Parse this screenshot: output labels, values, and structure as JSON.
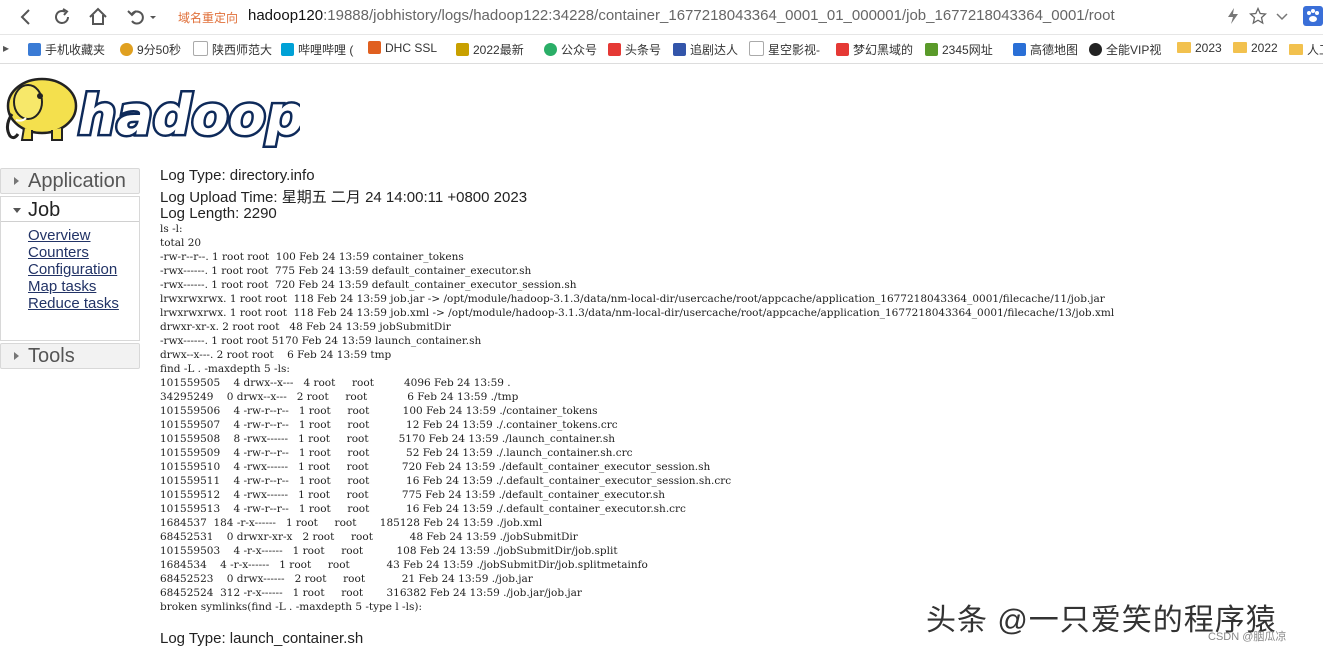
{
  "browser": {
    "redirect_label": "域名重定向",
    "url_host": "hadoop120",
    "url_rest": ":19888/jobhistory/logs/hadoop122:34228/container_1677218043364_0001_01_000001/job_1677218043364_0001/root"
  },
  "bookmarks": [
    {
      "label": "手机收藏夹",
      "icon": "phone-bookmark-icon",
      "color": "#3a7bd5"
    },
    {
      "label": "9分50秒",
      "icon": "trophy-icon",
      "color": "#e0a020"
    },
    {
      "label": "陕西师范大",
      "icon": "page-icon",
      "color": "#bbbbbb"
    },
    {
      "label": "哔哩哔哩 (",
      "icon": "bilibili-icon",
      "color": "#00a1d6"
    },
    {
      "label": "DHC SSL",
      "icon": "dhc-icon",
      "color": "#e06020"
    },
    {
      "label": "2022最新",
      "icon": "news-icon",
      "color": "#c8a000"
    },
    {
      "label": "公众号",
      "icon": "wechat-icon",
      "color": "#2aae67"
    },
    {
      "label": "头条号",
      "icon": "toutiao-icon",
      "color": "#e53935"
    },
    {
      "label": "追剧达人",
      "icon": "tv-icon",
      "color": "#3355aa"
    },
    {
      "label": "星空影视-",
      "icon": "page-icon",
      "color": "#bbbbbb"
    },
    {
      "label": "梦幻黑域的",
      "icon": "c-icon",
      "color": "#e53935"
    },
    {
      "label": "2345网址",
      "icon": "2345-icon",
      "color": "#5a9a2a"
    },
    {
      "label": "高德地图",
      "icon": "map-arrow-icon",
      "color": "#2a6fd6"
    },
    {
      "label": "全能VIP视",
      "icon": "vip-icon",
      "color": "#222222"
    },
    {
      "label": "2023",
      "icon": "folder-icon",
      "color": "#f2c14e"
    },
    {
      "label": "2022",
      "icon": "folder-icon",
      "color": "#f2c14e"
    },
    {
      "label": "人工",
      "icon": "folder-icon",
      "color": "#f2c14e"
    }
  ],
  "logo": {
    "text": "hadoop"
  },
  "sidebar": {
    "application": "Application",
    "job": "Job",
    "job_links": [
      "Overview",
      "Counters",
      "Configuration",
      "Map tasks",
      "Reduce tasks"
    ],
    "tools": "Tools"
  },
  "log": {
    "type": "Log Type: directory.info",
    "upload_time": "Log Upload Time: 星期五 二月 24 14:00:11 +0800 2023",
    "length": "Log Length: 2290",
    "body": "ls -l:\ntotal 20\n-rw-r--r--. 1 root root  100 Feb 24 13:59 container_tokens\n-rwx------. 1 root root  775 Feb 24 13:59 default_container_executor.sh\n-rwx------. 1 root root  720 Feb 24 13:59 default_container_executor_session.sh\nlrwxrwxrwx. 1 root root  118 Feb 24 13:59 job.jar -> /opt/module/hadoop-3.1.3/data/nm-local-dir/usercache/root/appcache/application_1677218043364_0001/filecache/11/job.jar\nlrwxrwxrwx. 1 root root  118 Feb 24 13:59 job.xml -> /opt/module/hadoop-3.1.3/data/nm-local-dir/usercache/root/appcache/application_1677218043364_0001/filecache/13/job.xml\ndrwxr-xr-x. 2 root root   48 Feb 24 13:59 jobSubmitDir\n-rwx------. 1 root root 5170 Feb 24 13:59 launch_container.sh\ndrwx--x---. 2 root root    6 Feb 24 13:59 tmp\nfind -L . -maxdepth 5 -ls:\n101559505    4 drwx--x---   4 root     root         4096 Feb 24 13:59 .\n34295249    0 drwx--x---   2 root     root            6 Feb 24 13:59 ./tmp\n101559506    4 -rw-r--r--   1 root     root          100 Feb 24 13:59 ./container_tokens\n101559507    4 -rw-r--r--   1 root     root           12 Feb 24 13:59 ./.container_tokens.crc\n101559508    8 -rwx------   1 root     root         5170 Feb 24 13:59 ./launch_container.sh\n101559509    4 -rw-r--r--   1 root     root           52 Feb 24 13:59 ./.launch_container.sh.crc\n101559510    4 -rwx------   1 root     root          720 Feb 24 13:59 ./default_container_executor_session.sh\n101559511    4 -rw-r--r--   1 root     root           16 Feb 24 13:59 ./.default_container_executor_session.sh.crc\n101559512    4 -rwx------   1 root     root          775 Feb 24 13:59 ./default_container_executor.sh\n101559513    4 -rw-r--r--   1 root     root           16 Feb 24 13:59 ./.default_container_executor.sh.crc\n1684537  184 -r-x------   1 root     root       185128 Feb 24 13:59 ./job.xml\n68452531    0 drwxr-xr-x   2 root     root           48 Feb 24 13:59 ./jobSubmitDir\n101559503    4 -r-x------   1 root     root          108 Feb 24 13:59 ./jobSubmitDir/job.split\n1684534    4 -r-x------   1 root     root           43 Feb 24 13:59 ./jobSubmitDir/job.splitmetainfo\n68452523    0 drwx------   2 root     root           21 Feb 24 13:59 ./job.jar\n68452524  312 -r-x------   1 root     root       316382 Feb 24 13:59 ./job.jar/job.jar\nbroken symlinks(find -L . -maxdepth 5 -type l -ls):",
    "next_type": "Log Type: launch_container.sh"
  },
  "watermark": {
    "text": "头条 @一只爱笑的程序猿",
    "csdn": "CSDN @胭瓜凉"
  }
}
